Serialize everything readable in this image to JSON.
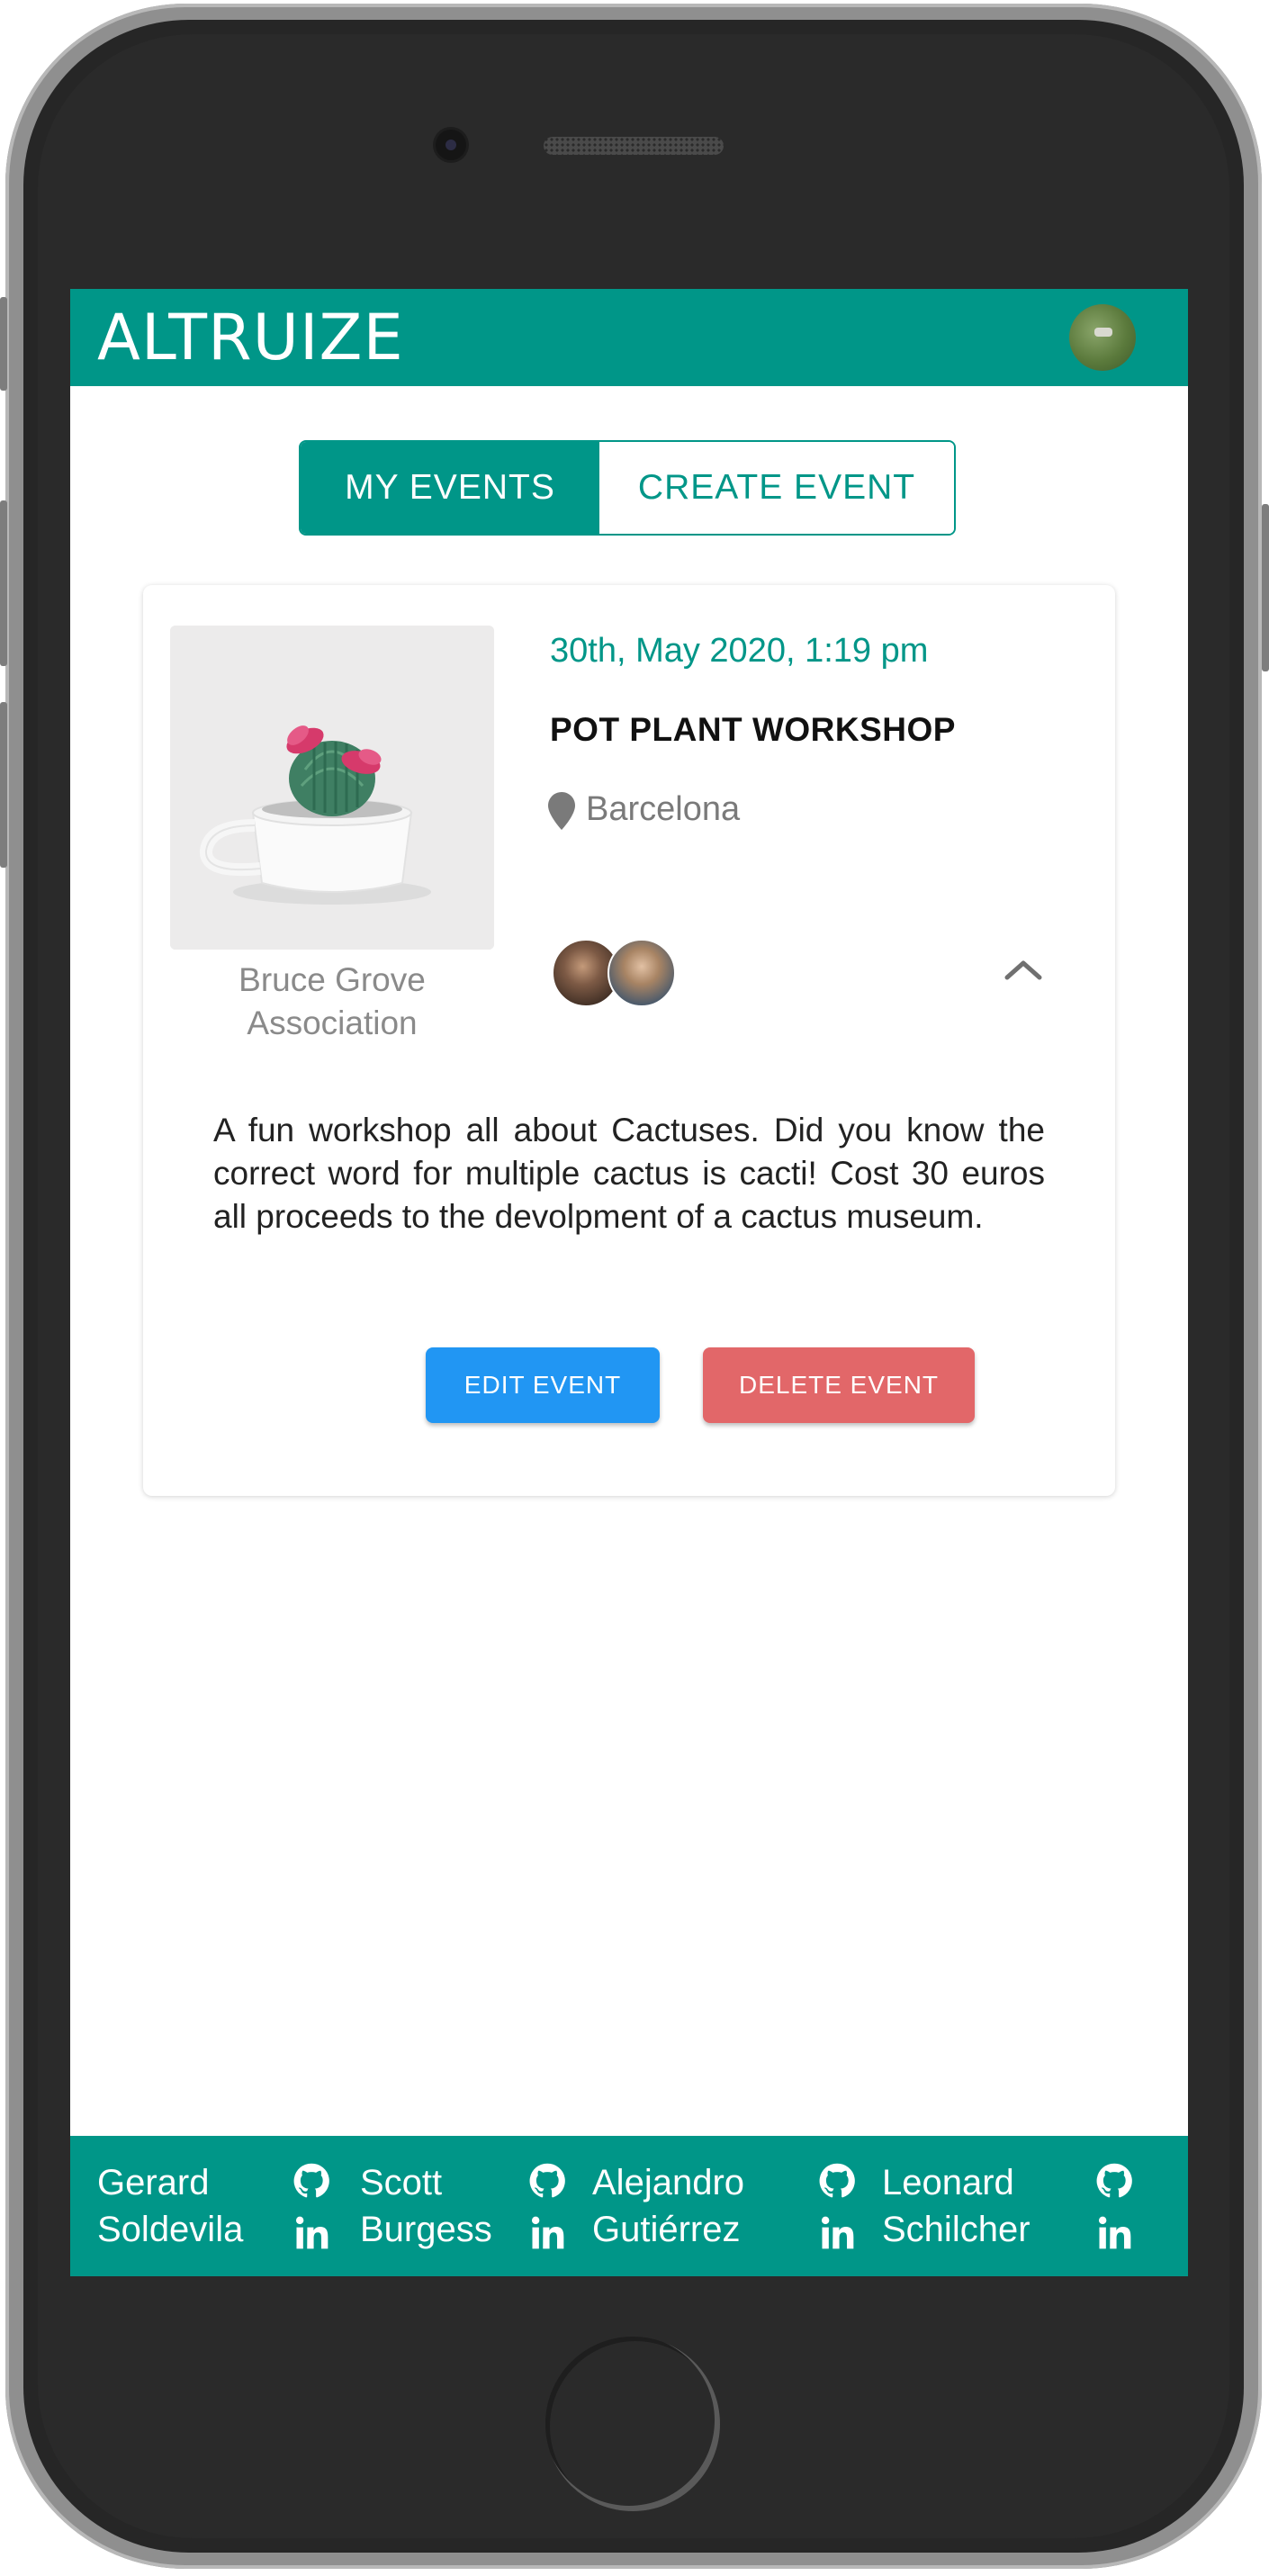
{
  "app": {
    "title": "ALTRUIZE"
  },
  "tabs": [
    {
      "label": "MY EVENTS",
      "active": true
    },
    {
      "label": "CREATE EVENT",
      "active": false
    }
  ],
  "event": {
    "date": "30th, May 2020, 1:19 pm",
    "title": "POT PLANT WORKSHOP",
    "location": "Barcelona",
    "organizer": "Bruce Grove Association",
    "description": "A fun workshop all about Cactuses. Did you know the correct word for multiple cactus is cacti! Cost 30 euros all proceeds to the devolpment of a cactus museum.",
    "edit_label": "EDIT EVENT",
    "delete_label": "DELETE EVENT"
  },
  "footer": {
    "members": [
      {
        "first": "Gerard",
        "last": "Soldevila"
      },
      {
        "first": "Scott",
        "last": "Burgess"
      },
      {
        "first": "Alejandro",
        "last": "Gutiérrez"
      },
      {
        "first": "Leonard",
        "last": "Schilcher"
      }
    ]
  },
  "colors": {
    "primary": "#009688",
    "edit": "#2196f3",
    "delete": "#e26769"
  },
  "icons": {
    "location": "map-marker-icon",
    "collapse": "chevron-up-icon",
    "github": "github-icon",
    "linkedin": "linkedin-icon"
  }
}
